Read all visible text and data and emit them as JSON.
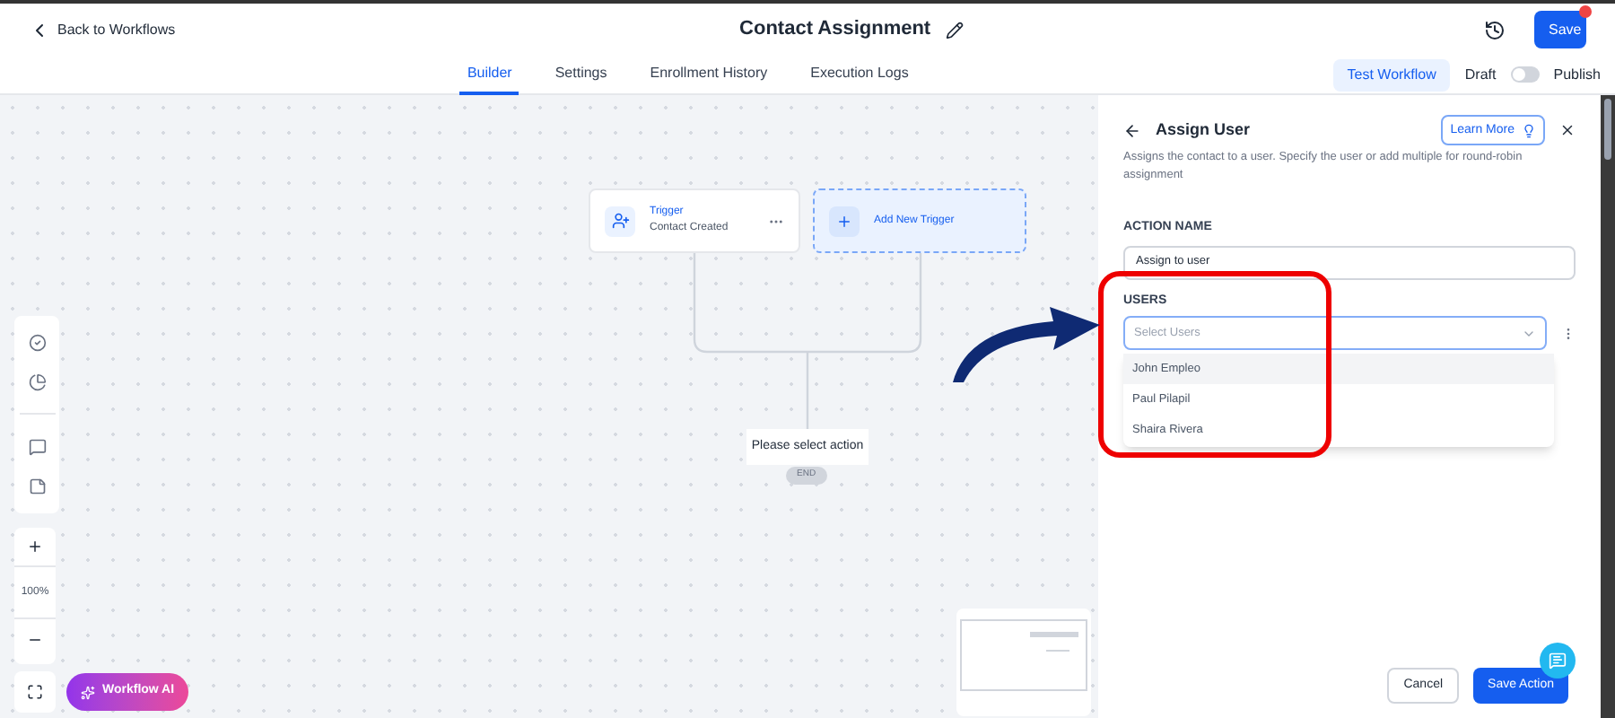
{
  "header": {
    "back": "Back to Workflows",
    "title": "Contact Assignment",
    "save": "Save",
    "save_badge": true
  },
  "tabs": [
    {
      "label": "Builder",
      "selected": true
    },
    {
      "label": "Settings",
      "selected": false
    },
    {
      "label": "Enrollment History",
      "selected": false
    },
    {
      "label": "Execution Logs",
      "selected": false
    }
  ],
  "test_workflow": "Test Workflow",
  "publish": {
    "off_label": "Draft",
    "on_label": "Publish",
    "on": false
  },
  "canvas": {
    "trigger": {
      "title": "Trigger",
      "subtitle": "Contact Created"
    },
    "add_trigger": "Add New Trigger",
    "action_placeholder": "Please select action",
    "end": "END",
    "zoom": "100%",
    "ai_button": "Workflow AI"
  },
  "panel": {
    "title": "Assign User",
    "learn_more": "Learn More",
    "description": "Assigns the contact to a user. Specify the user or add multiple for round-robin assignment",
    "action_name_label": "ACTION NAME",
    "action_name": "Assign to user",
    "users_label": "USERS",
    "users_placeholder": "Select Users",
    "options": [
      {
        "label": "John Empleo",
        "selected": true
      },
      {
        "label": "Paul Pilapil",
        "selected": false
      },
      {
        "label": "Shaira Rivera",
        "selected": false
      }
    ],
    "cancel": "Cancel",
    "save_action": "Save Action"
  }
}
